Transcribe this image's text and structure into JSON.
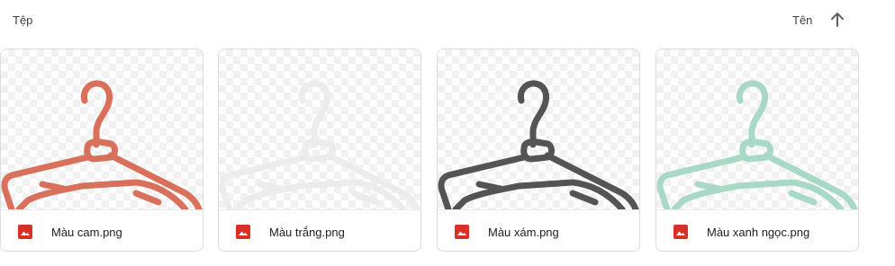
{
  "header": {
    "section_title": "Tệp",
    "sort_label": "Tên",
    "sort_icon": "arrow-up-icon"
  },
  "files": [
    {
      "name": "Màu cam.png",
      "color": "#d9705c",
      "icon": "image-file-icon"
    },
    {
      "name": "Màu trắng.png",
      "color": "#ececec",
      "icon": "image-file-icon"
    },
    {
      "name": "Màu xám.png",
      "color": "#545454",
      "icon": "image-file-icon"
    },
    {
      "name": "Màu xanh ngọc.png",
      "color": "#a8d8c6",
      "icon": "image-file-icon"
    }
  ],
  "colors": {
    "file_icon_red": "#d93025",
    "border": "#dadce0"
  }
}
